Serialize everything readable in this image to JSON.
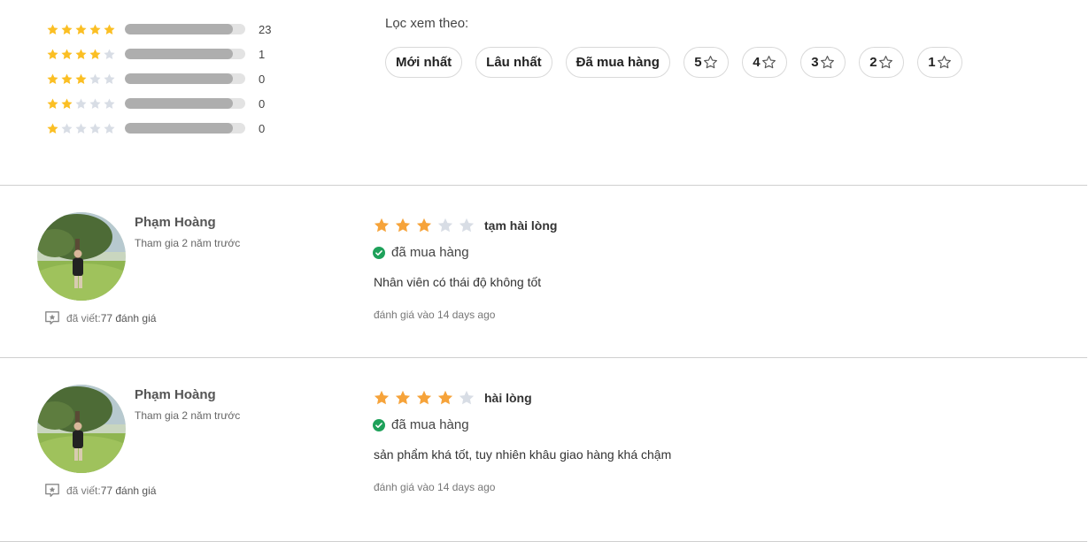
{
  "colors": {
    "star_filled": "#fbbf24",
    "star_empty": "#d8dde5",
    "review_star_filled": "#f6a33a",
    "check_green": "#1ea15a"
  },
  "rating_summary": [
    {
      "stars": 5,
      "count": "23",
      "fill": 0.9
    },
    {
      "stars": 4,
      "count": "1",
      "fill": 0.9
    },
    {
      "stars": 3,
      "count": "0",
      "fill": 0.9
    },
    {
      "stars": 2,
      "count": "0",
      "fill": 0.9
    },
    {
      "stars": 1,
      "count": "0",
      "fill": 0.9
    }
  ],
  "filter": {
    "label": "Lọc xem theo:",
    "chips": [
      {
        "label": "Mới nhất"
      },
      {
        "label": "Lâu nhất"
      },
      {
        "label": "Đã mua hàng"
      },
      {
        "label": "5",
        "icon": "star-outline-icon"
      },
      {
        "label": "4",
        "icon": "star-outline-icon"
      },
      {
        "label": "3",
        "icon": "star-outline-icon"
      },
      {
        "label": "2",
        "icon": "star-outline-icon"
      },
      {
        "label": "1",
        "icon": "star-outline-icon"
      }
    ]
  },
  "reviews": [
    {
      "name": "Phạm Hoàng",
      "joined": "Tham gia 2 năm trước",
      "written_label": "đã viết:",
      "written_count": "77 đánh giá",
      "rating": 3,
      "verdict": "tạm hài lòng",
      "bought": "đã mua hàng",
      "content": "Nhân viên có thái độ không tốt",
      "date": "đánh giá vào 14 days ago"
    },
    {
      "name": "Phạm Hoàng",
      "joined": "Tham gia 2 năm trước",
      "written_label": "đã viết:",
      "written_count": "77 đánh giá",
      "rating": 4,
      "verdict": "hài lòng",
      "bought": "đã mua hàng",
      "content": "sản phẩm khá tốt, tuy nhiên khâu giao hàng khá chậm",
      "date": "đánh giá vào 14 days ago"
    }
  ]
}
